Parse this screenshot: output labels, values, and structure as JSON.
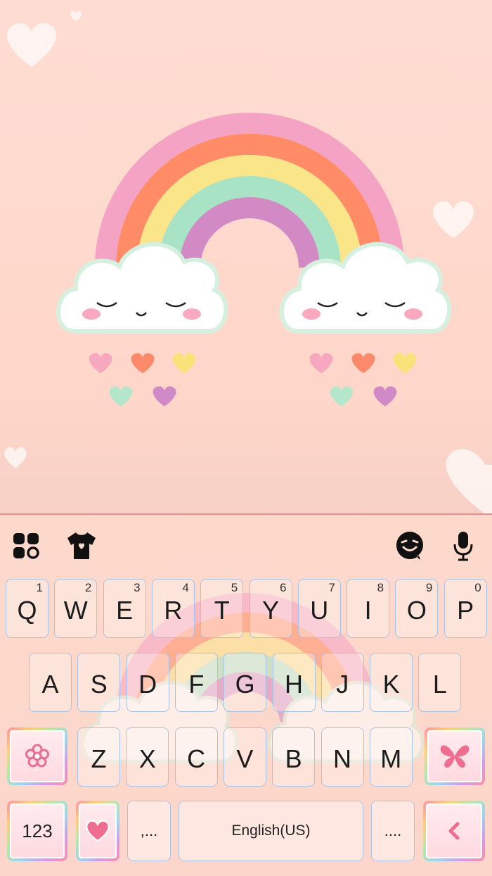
{
  "toolbar": {
    "icons": [
      "apps-grid-icon",
      "theme-shirt-icon",
      "emoji-sticker-icon",
      "microphone-icon"
    ]
  },
  "keyboard": {
    "row1": [
      {
        "key": "Q",
        "hint": "1"
      },
      {
        "key": "W",
        "hint": "2"
      },
      {
        "key": "E",
        "hint": "3"
      },
      {
        "key": "R",
        "hint": "4"
      },
      {
        "key": "T",
        "hint": "5"
      },
      {
        "key": "Y",
        "hint": "6"
      },
      {
        "key": "U",
        "hint": "7"
      },
      {
        "key": "I",
        "hint": "8"
      },
      {
        "key": "O",
        "hint": "9"
      },
      {
        "key": "P",
        "hint": "0"
      }
    ],
    "row2": [
      "A",
      "S",
      "D",
      "F",
      "G",
      "H",
      "J",
      "K",
      "L"
    ],
    "row3": [
      "Z",
      "X",
      "C",
      "V",
      "B",
      "N",
      "M"
    ],
    "shift_icon": "flower-shift-icon",
    "backspace_icon": "butterfly-backspace-icon",
    "bottom": {
      "numbers_label": "123",
      "emoji_icon": "heart-icon",
      "comma_label": ",...",
      "space_label": "English(US)",
      "period_label": "....",
      "enter_icon": "chevron-left-icon"
    }
  },
  "colors": {
    "background": "#ffdcd2",
    "key_border": "#a8c2e4",
    "rainbow": [
      "#f5a3c4",
      "#ff8c67",
      "#fbe589",
      "#a8e3c5",
      "#d18ac4"
    ],
    "heart_colors": [
      "#f7a8be",
      "#fb8a6a",
      "#f9e27a",
      "#b4e6cc",
      "#d08ac8"
    ]
  }
}
